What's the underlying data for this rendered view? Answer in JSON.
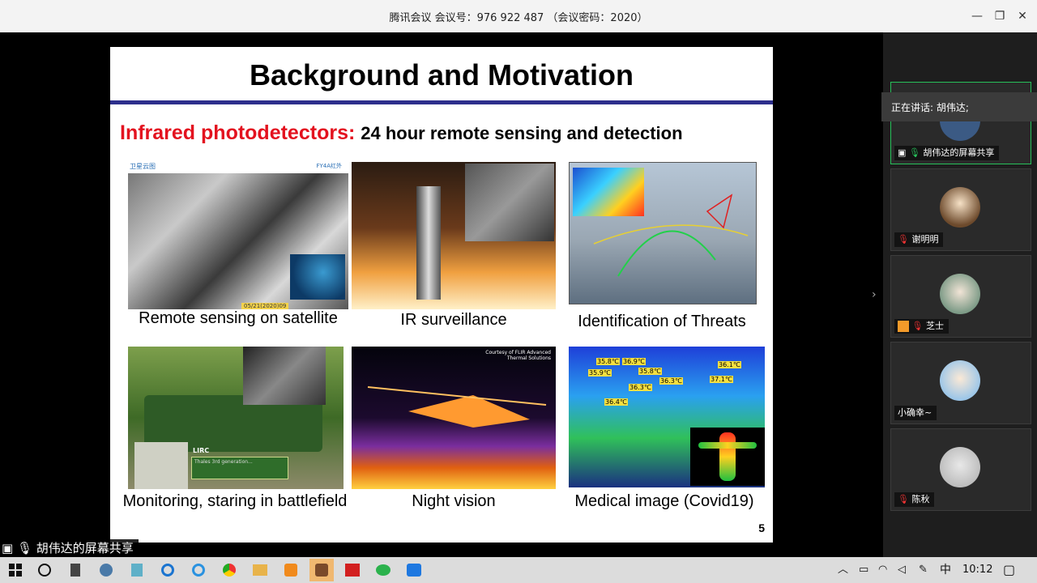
{
  "window": {
    "title": "腾讯会议 会议号：976 922 487 （会议密码：2020）",
    "minimize": "—",
    "restore": "❐",
    "close": "✕"
  },
  "slide": {
    "title": "Background and Motivation",
    "subtitle_highlight": "Infrared photodetectors:",
    "subtitle_rest": "24 hour remote sensing and detection",
    "page_number": "5",
    "panels": [
      {
        "caption": "Remote sensing on satellite",
        "label_tl": "卫星云图",
        "label_tr": "FY4A红外",
        "label_bottom": "05/21(2020)09"
      },
      {
        "caption": "IR surveillance"
      },
      {
        "caption": "Identification of Threats"
      },
      {
        "caption": "Monitoring, staring in battlefield",
        "label": "LIRC",
        "note": "Thales 3rd generation..."
      },
      {
        "caption": "Night vision",
        "credit": "Courtesy of FLIR Advanced Thermal Solutions"
      },
      {
        "caption": "Medical image (Covid19)",
        "temps": [
          "35.8℃",
          "36.9℃",
          "35.9℃",
          "35.8℃",
          "36.1℃",
          "36.3℃",
          "37.1℃",
          "36.3℃",
          "36.4℃"
        ]
      }
    ]
  },
  "sidebar": {
    "speaking": "正在讲话: 胡伟达;",
    "participants": [
      {
        "name": "胡伟达的屏幕共享",
        "active": true
      },
      {
        "name": "谢明明",
        "active": false
      },
      {
        "name": "芝士",
        "active": false
      },
      {
        "name": "小确幸~",
        "active": false
      },
      {
        "name": "陈秋",
        "active": false
      }
    ]
  },
  "share_label": "胡伟达的屏幕共享",
  "taskbar": {
    "ime": "中",
    "time": "10:12"
  },
  "colors": {
    "subtitle_red": "#e3121f",
    "rule_blue": "#2d2f8c",
    "active_green": "#27c05a"
  }
}
